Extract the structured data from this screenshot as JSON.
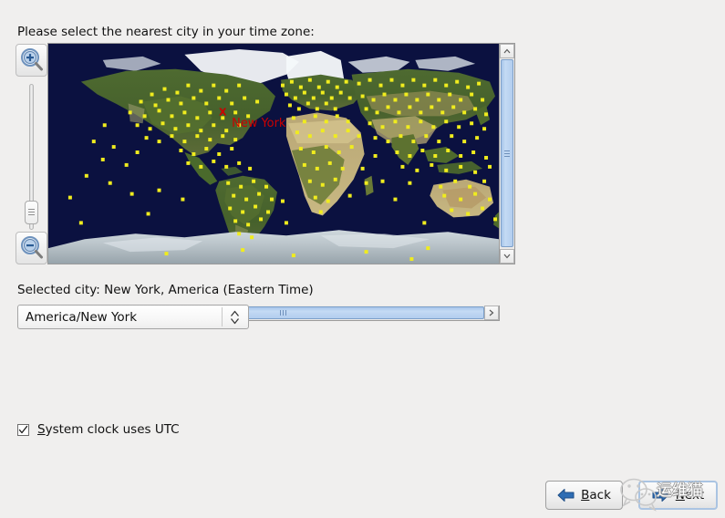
{
  "prompt": "Please select the nearest city in your time zone:",
  "map": {
    "marker_label": "New York",
    "marker_symbol": "X",
    "marker_color": "#cc0000",
    "ocean_color": "#0b1140",
    "city_dot_color": "#f0ec1e",
    "land_color": "#3f5a2a",
    "ice_color": "#e8eef2",
    "zoom_in_label": "Zoom in",
    "zoom_out_label": "Zoom out",
    "slider_name": "Zoom level"
  },
  "scrollbars": {
    "v_up": "▲",
    "v_down": "▼",
    "h_left": "◀",
    "h_right": "▶"
  },
  "selected_city": {
    "text": "Selected city: New York, America (Eastern Time)"
  },
  "timezone_combo": {
    "value": "America/New York",
    "options": [
      "America/New York"
    ]
  },
  "utc_checkbox": {
    "checked": true,
    "label_prefix": "",
    "mnemonic": "S",
    "label_rest": "ystem clock uses UTC",
    "full_label": "System clock uses UTC"
  },
  "buttons": {
    "back": {
      "mnemonic": "B",
      "rest": "ack",
      "full": "Back"
    },
    "next": {
      "mnemonic": "N",
      "rest": "ext",
      "full": "Next",
      "focused": true
    }
  },
  "watermark": {
    "text": "运维猫"
  },
  "colors": {
    "window_bg": "#f0efee",
    "arrow_blue": "#2e6db4",
    "scroll_thumb": "#b2cdee",
    "focus_ring": "#aac4e2"
  }
}
